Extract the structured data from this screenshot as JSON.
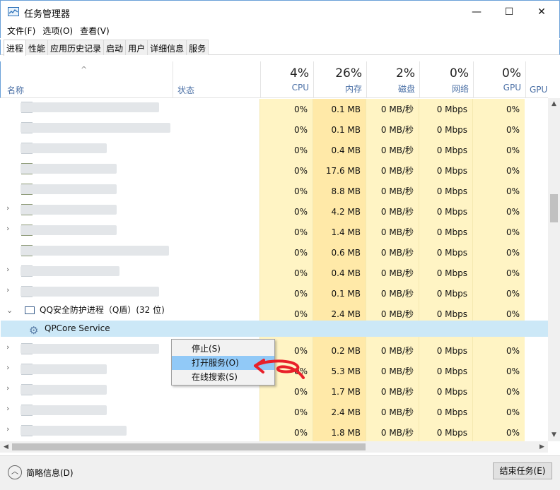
{
  "window": {
    "title": "任务管理器",
    "minimize_glyph": "—",
    "maximize_glyph": "☐",
    "close_glyph": "✕"
  },
  "menu": [
    "文件(F)",
    "选项(O)",
    "查看(V)"
  ],
  "tabs": [
    "进程",
    "性能",
    "应用历史记录",
    "启动",
    "用户",
    "详细信息",
    "服务"
  ],
  "header": {
    "name": "名称",
    "status": "状态",
    "cpu": {
      "pct": "4%",
      "label": "CPU"
    },
    "memory": {
      "pct": "26%",
      "label": "内存"
    },
    "disk": {
      "pct": "2%",
      "label": "磁盘"
    },
    "network": {
      "pct": "0%",
      "label": "网络"
    },
    "gpu": {
      "pct": "0%",
      "label": "GPU"
    },
    "gpu_engine": "GPU 引擎"
  },
  "rows": [
    {
      "cpu": "0%",
      "mem": "0.1 MB",
      "disk": "0 MB/秒",
      "net": "0 Mbps",
      "gpu": "0%"
    },
    {
      "cpu": "0%",
      "mem": "0.1 MB",
      "disk": "0 MB/秒",
      "net": "0 Mbps",
      "gpu": "0%"
    },
    {
      "cpu": "0%",
      "mem": "0.4 MB",
      "disk": "0 MB/秒",
      "net": "0 Mbps",
      "gpu": "0%"
    },
    {
      "cpu": "0%",
      "mem": "17.6 MB",
      "disk": "0 MB/秒",
      "net": "0 Mbps",
      "gpu": "0%"
    },
    {
      "cpu": "0%",
      "mem": "8.8 MB",
      "disk": "0 MB/秒",
      "net": "0 Mbps",
      "gpu": "0%"
    },
    {
      "cpu": "0%",
      "mem": "4.2 MB",
      "disk": "0 MB/秒",
      "net": "0 Mbps",
      "gpu": "0%"
    },
    {
      "cpu": "0%",
      "mem": "1.4 MB",
      "disk": "0 MB/秒",
      "net": "0 Mbps",
      "gpu": "0%"
    },
    {
      "cpu": "0%",
      "mem": "0.6 MB",
      "disk": "0 MB/秒",
      "net": "0 Mbps",
      "gpu": "0%"
    },
    {
      "cpu": "0%",
      "mem": "0.4 MB",
      "disk": "0 MB/秒",
      "net": "0 Mbps",
      "gpu": "0%"
    },
    {
      "cpu": "0%",
      "mem": "0.1 MB",
      "disk": "0 MB/秒",
      "net": "0 Mbps",
      "gpu": "0%"
    }
  ],
  "qq_row": {
    "name": "QQ安全防护进程（Q盾）(32 位)",
    "cpu": "0%",
    "mem": "2.4 MB",
    "disk": "0 MB/秒",
    "net": "0 Mbps",
    "gpu": "0%"
  },
  "service_row": {
    "name": "QPCore Service"
  },
  "rows_after": [
    {
      "cpu": "0%",
      "mem": "0.2 MB",
      "disk": "0 MB/秒",
      "net": "0 Mbps",
      "gpu": "0%"
    },
    {
      "cpu": "0%",
      "mem": "5.3 MB",
      "disk": "0 MB/秒",
      "net": "0 Mbps",
      "gpu": "0%"
    },
    {
      "cpu": "0%",
      "mem": "1.7 MB",
      "disk": "0 MB/秒",
      "net": "0 Mbps",
      "gpu": "0%"
    },
    {
      "cpu": "0%",
      "mem": "2.4 MB",
      "disk": "0 MB/秒",
      "net": "0 Mbps",
      "gpu": "0%"
    },
    {
      "cpu": "0%",
      "mem": "1.8 MB",
      "disk": "0 MB/秒",
      "net": "0 Mbps",
      "gpu": "0%"
    }
  ],
  "context_menu": [
    "停止(S)",
    "打开服务(O)",
    "在线搜索(S)"
  ],
  "footer": {
    "collapse_label": "简略信息(D)",
    "end_task": "结束任务(E)"
  },
  "colors": {
    "accent": "#4a6fa5",
    "cpu_col": "#fff4c4",
    "mem_col": "#ffe9a8",
    "selected_row": "#cce8f7",
    "menu_highlight": "#91c9f7",
    "annotation": "#e8202a"
  }
}
